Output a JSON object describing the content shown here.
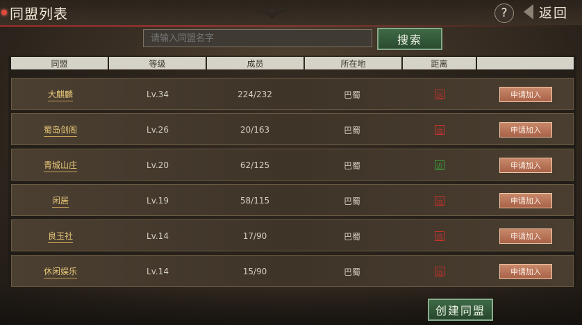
{
  "header": {
    "title": "同盟列表",
    "help_label": "?",
    "back_label": "返回"
  },
  "search": {
    "placeholder": "请输入同盟名字",
    "button_label": "搜索"
  },
  "table": {
    "columns": [
      "同盟",
      "等级",
      "成员",
      "所在地",
      "距离",
      ""
    ],
    "rows": [
      {
        "name": "大麒麟",
        "level": "Lv.34",
        "members": "224/232",
        "location": "巴蜀",
        "distance": "远",
        "distance_color": "#c8322c",
        "join": "申请加入"
      },
      {
        "name": "蜀岛剑阁",
        "level": "Lv.26",
        "members": "20/163",
        "location": "巴蜀",
        "distance": "远",
        "distance_color": "#c8322c",
        "join": "申请加入"
      },
      {
        "name": "青城山庄",
        "level": "Lv.20",
        "members": "62/125",
        "location": "巴蜀",
        "distance": "近",
        "distance_color": "#3c9a3a",
        "join": "申请加入"
      },
      {
        "name": "闲居",
        "level": "Lv.19",
        "members": "58/115",
        "location": "巴蜀",
        "distance": "远",
        "distance_color": "#c8322c",
        "join": "申请加入"
      },
      {
        "name": "良玉社",
        "level": "Lv.14",
        "members": "17/90",
        "location": "巴蜀",
        "distance": "远",
        "distance_color": "#c8322c",
        "join": "申请加入"
      },
      {
        "name": "休闲娱乐",
        "level": "Lv.14",
        "members": "15/90",
        "location": "巴蜀",
        "distance": "远",
        "distance_color": "#c8322c",
        "join": "申请加入"
      }
    ]
  },
  "footer": {
    "create_label": "创建同盟"
  }
}
